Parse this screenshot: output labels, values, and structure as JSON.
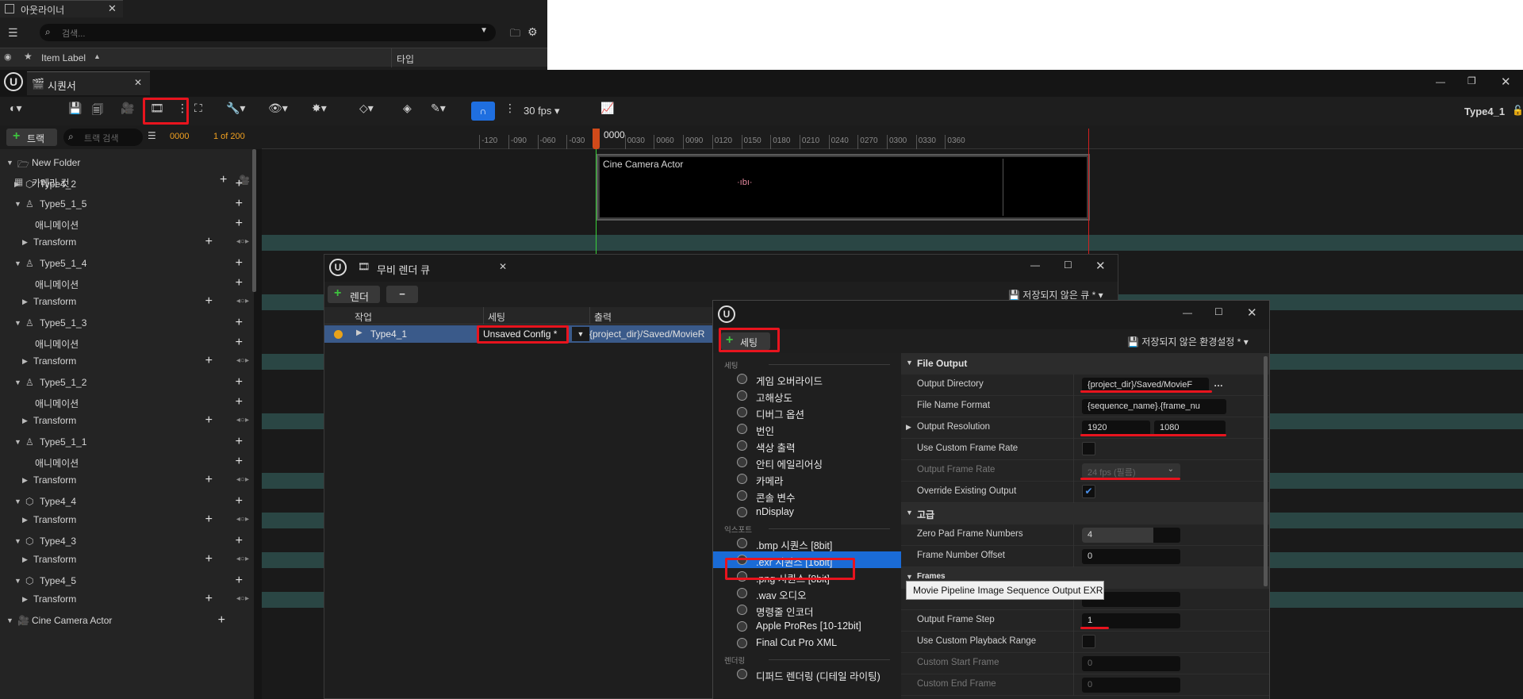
{
  "outliner": {
    "tab_title": "아웃라이너",
    "search_placeholder": "검색...",
    "col_item_label": "Item Label",
    "col_type": "타입"
  },
  "sequencer": {
    "tab_title": "시퀀서",
    "fps": "30 fps",
    "sequence_name": "Type4_1",
    "track_button": "트랙",
    "track_search_placeholder": "트랙 검색",
    "current_frame": "0000",
    "frame_counter": "1 of 200",
    "playhead_label": "0000",
    "ruler_ticks": [
      "-120",
      "-090",
      "-060",
      "-030",
      "0030",
      "0060",
      "0090",
      "0120",
      "0150",
      "0180",
      "0210",
      "0240",
      "0270",
      "0300",
      "0330",
      "0360"
    ],
    "camera_cuts": "카메라 컷",
    "tracks": [
      {
        "label": "New Folder"
      },
      {
        "label": "Type4_2"
      },
      {
        "label": "Type5_1_5"
      },
      {
        "label": "애니메이션"
      },
      {
        "label": "Transform"
      },
      {
        "label": "Type5_1_4"
      },
      {
        "label": "애니메이션"
      },
      {
        "label": "Transform"
      },
      {
        "label": "Type5_1_3"
      },
      {
        "label": "애니메이션"
      },
      {
        "label": "Transform"
      },
      {
        "label": "Type5_1_2"
      },
      {
        "label": "애니메이션"
      },
      {
        "label": "Transform"
      },
      {
        "label": "Type5_1_1"
      },
      {
        "label": "애니메이션"
      },
      {
        "label": "Transform"
      },
      {
        "label": "Type4_4"
      },
      {
        "label": "Transform"
      },
      {
        "label": "Type4_3"
      },
      {
        "label": "Transform"
      },
      {
        "label": "Type4_5"
      },
      {
        "label": "Transform"
      },
      {
        "label": "Cine Camera Actor"
      }
    ],
    "shot_label": "Cine Camera Actor"
  },
  "render_queue": {
    "title": "무비 렌더 큐",
    "render_button": "렌더",
    "remove_button": "−",
    "unsaved_queue": "저장되지 않은 큐 *",
    "col_job": "작업",
    "col_settings": "세팅",
    "col_output": "출력",
    "job_name": "Type4_1",
    "job_config": "Unsaved Config *",
    "job_output": "{project_dir}/Saved/MovieR"
  },
  "settings_window": {
    "add_setting_button": "세팅",
    "unsaved_preset": "저장되지 않은 환경설정 *",
    "menu_categories": {
      "settings": "세팅",
      "export": "익스포트",
      "rendering": "렌더링"
    },
    "menu_settings_items": [
      "게임 오버라이드",
      "고해상도",
      "디버그 옵션",
      "번인",
      "색상 출력",
      "안티 에일리어싱",
      "카메라",
      "콘솔 변수",
      "nDisplay"
    ],
    "menu_export_items": [
      ".bmp 시퀀스 [8bit]",
      ".exr 시퀀스 [16bit]",
      ".png 시퀀스 [8bit]",
      ".wav 오디오",
      "명령줄 인코더",
      "Apple ProRes [10-12bit]",
      "Final Cut Pro XML"
    ],
    "menu_render_items": [
      "디퍼드 렌더링 (디테일 라이팅)"
    ],
    "tooltip": "Movie Pipeline Image Sequence Output EXR",
    "details": {
      "section_file_output": "File Output",
      "output_directory_label": "Output Directory",
      "output_directory_value": "{project_dir}/Saved/MovieF",
      "file_name_format_label": "File Name Format",
      "file_name_format_value": "{sequence_name}.{frame_nu",
      "output_resolution_label": "Output Resolution",
      "res_x": "1920",
      "res_y": "1080",
      "use_custom_frame_rate_label": "Use Custom Frame Rate",
      "output_frame_rate_label": "Output Frame Rate",
      "output_frame_rate_value": "24 fps (필름)",
      "override_existing_label": "Override Existing Output",
      "section_advanced": "고급",
      "zero_pad_label": "Zero Pad Frame Numbers",
      "zero_pad_value": "4",
      "frame_number_offset_label": "Frame Number Offset",
      "frame_number_offset_value": "0",
      "section_frames": "Frames",
      "output_frame_step_label": "Output Frame Step",
      "output_frame_step_value": "1",
      "use_custom_playback_label": "Use Custom Playback Range",
      "custom_start_label": "Custom Start Frame",
      "custom_start_value": "0",
      "custom_end_label": "Custom End Frame",
      "custom_end_value": "0"
    }
  },
  "colors": {
    "highlight_red": "#e8141e",
    "selection_blue": "#1a6bd6",
    "accent_orange": "#f0a020",
    "track_band": "#2a4644"
  }
}
